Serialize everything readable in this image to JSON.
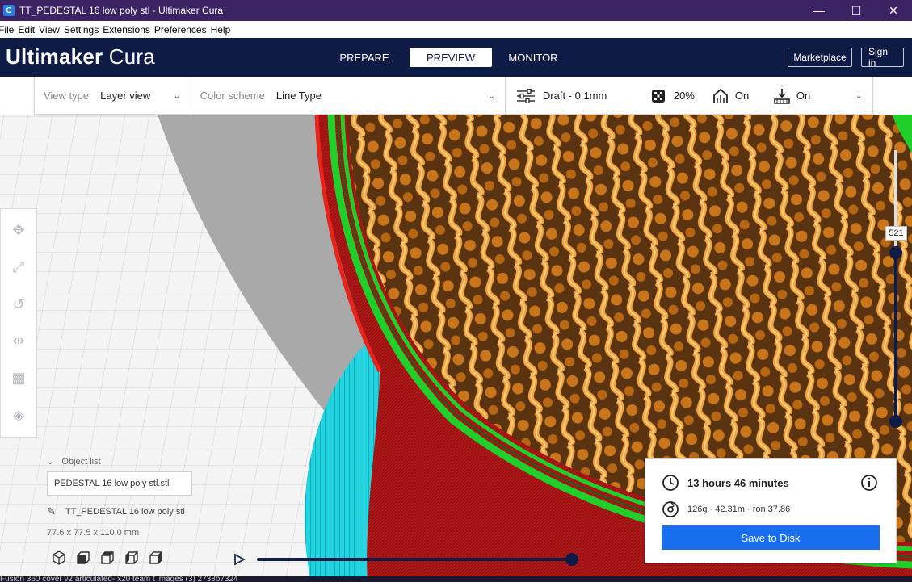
{
  "window": {
    "title": "TT_PEDESTAL 16 low poly stl - Ultimaker Cura",
    "app_icon": "C",
    "minimize": "—",
    "maximize": "☐",
    "close": "✕"
  },
  "menu": [
    "File",
    "Edit",
    "View",
    "Settings",
    "Extensions",
    "Preferences",
    "Help"
  ],
  "header": {
    "brand_bold": "Ultimaker",
    "brand_light": "Cura",
    "tabs": [
      {
        "label": "PREPARE",
        "active": false
      },
      {
        "label": "PREVIEW",
        "active": true
      },
      {
        "label": "MONITOR",
        "active": false
      }
    ],
    "marketplace": "Marketplace",
    "signin": "Sign in"
  },
  "toolbar": {
    "view_type_label": "View type",
    "view_type_value": "Layer view",
    "color_scheme_label": "Color scheme",
    "color_scheme_value": "Line Type",
    "profile": "Draft - 0.1mm",
    "infill": "20%",
    "support": "On",
    "adhesion": "On"
  },
  "layer_slider": {
    "value": "521"
  },
  "object_list": {
    "header": "Object list",
    "field_value": "PEDESTAL 16 low poly stl.stl",
    "file_name": "TT_PEDESTAL 16 low poly stl",
    "dimensions": "77.6 x 77.5 x 110.0 mm"
  },
  "print_info": {
    "time": "13 hours 46 minutes",
    "material": "126g · 42.31m · ron 37.86",
    "save_button": "Save to Disk"
  },
  "taskbar": {
    "text": "Fusion 360    cover v2    articulated-    x20 team t    images (3)    2738b7324"
  },
  "colors": {
    "titlebar": "#3c2464",
    "header": "#0f1b47",
    "accent": "#196ef0",
    "wall_outer": "#d42222",
    "wall_inner": "#2fd62f",
    "infill": "#f39a2c",
    "skirt": "#1fd0dc"
  }
}
